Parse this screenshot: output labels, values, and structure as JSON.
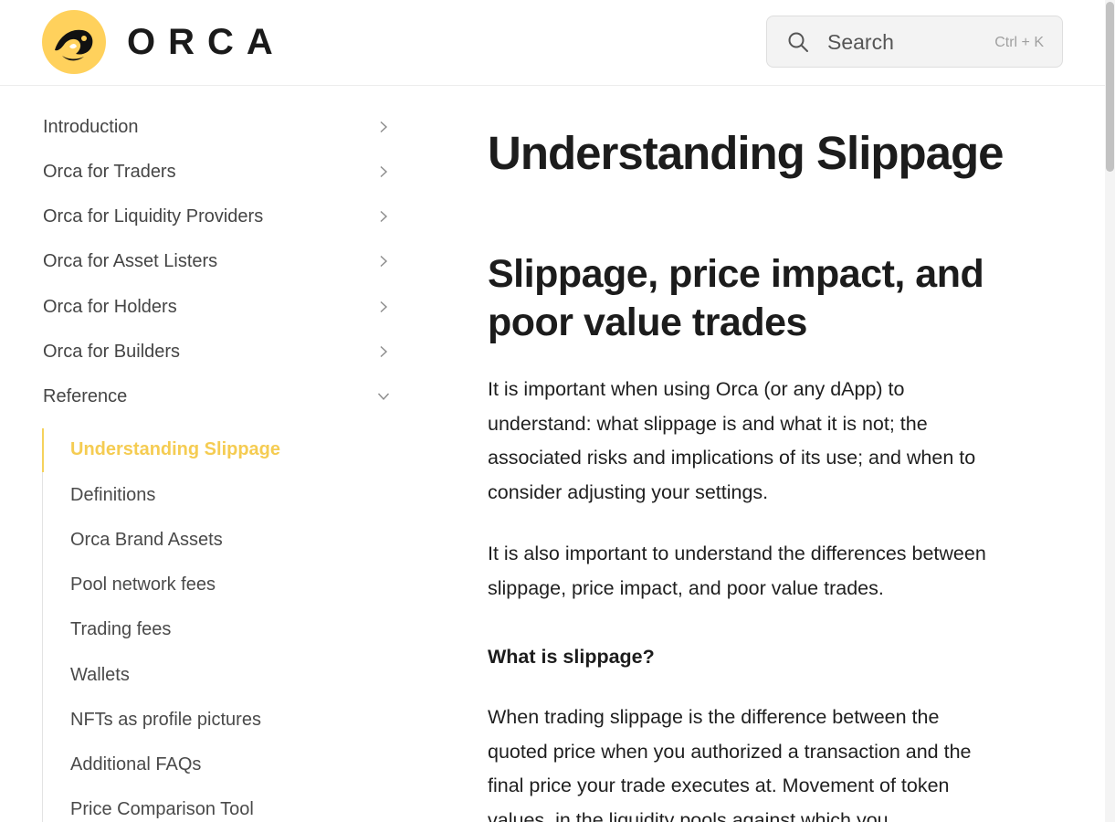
{
  "header": {
    "logo_text": "ORCA",
    "search_label": "Search",
    "search_shortcut": "Ctrl + K"
  },
  "sidebar": {
    "items": [
      {
        "label": "Introduction",
        "icon": "chevron-right-icon"
      },
      {
        "label": "Orca for Traders",
        "icon": "chevron-right-icon"
      },
      {
        "label": "Orca for Liquidity Providers",
        "icon": "chevron-right-icon"
      },
      {
        "label": "Orca for Asset Listers",
        "icon": "chevron-right-icon"
      },
      {
        "label": "Orca for Holders",
        "icon": "chevron-right-icon"
      },
      {
        "label": "Orca for Builders",
        "icon": "chevron-right-icon"
      },
      {
        "label": "Reference",
        "icon": "chevron-down-icon"
      }
    ],
    "sub_items": [
      {
        "label": "Understanding Slippage",
        "active": true
      },
      {
        "label": "Definitions"
      },
      {
        "label": "Orca Brand Assets"
      },
      {
        "label": "Pool network fees"
      },
      {
        "label": "Trading fees"
      },
      {
        "label": "Wallets"
      },
      {
        "label": "NFTs as profile pictures"
      },
      {
        "label": "Additional FAQs"
      },
      {
        "label": "Price Comparison Tool"
      }
    ]
  },
  "main": {
    "title": "Understanding Slippage",
    "section_heading": "Slippage, price impact, and poor value trades",
    "paragraphs": [
      "It is important when using Orca (or any dApp) to understand: what slippage is and what it is not; the associated risks and implications of its use; and when to consider adjusting your settings.",
      "It is also important to understand the differences between slippage, price impact, and poor value trades."
    ],
    "subheading": "What is slippage?",
    "paragraph_3": "When trading slippage is the difference between the quoted price when you authorized a transaction and the final price your trade executes at. Movement of token values, in the liquidity pools against which you"
  },
  "colors": {
    "brand_yellow": "#FFD15C",
    "active_link": "#F5CC52",
    "text": "#1F1F1F"
  }
}
